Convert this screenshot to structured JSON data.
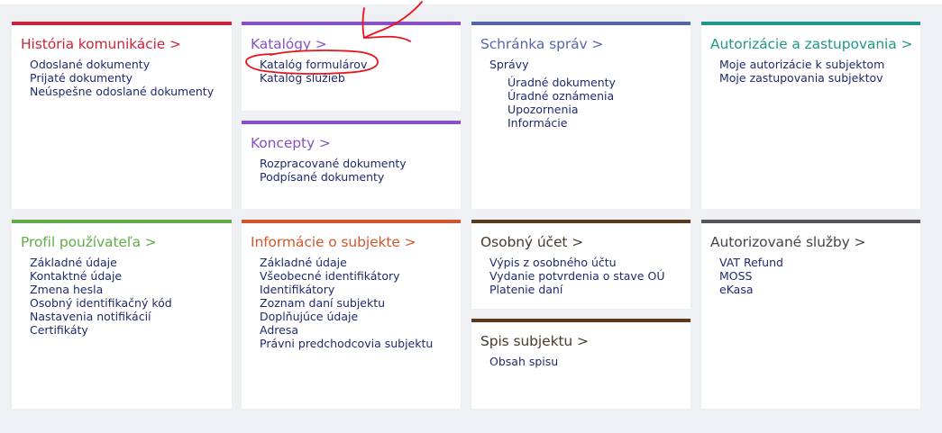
{
  "colors": {
    "red": "#c8253b",
    "purple": "#8750c4",
    "blue": "#5667a8",
    "teal": "#21968a",
    "green": "#5fad47",
    "orange": "#d2572d",
    "brown": "#5b3b1f",
    "gray": "#56565a",
    "annotation": "#e8141c"
  },
  "tiles": {
    "historia": {
      "title": "História komunikácie >",
      "links": [
        "Odoslané dokumenty",
        "Prijaté dokumenty",
        "Neúspešne odoslané dokumenty"
      ]
    },
    "katalogy": {
      "title": "Katalógy >",
      "links": [
        "Katalóg formulárov",
        "Katalóg služieb"
      ]
    },
    "koncepty": {
      "title": "Koncepty >",
      "links": [
        "Rozpracované dokumenty",
        "Podpísané dokumenty"
      ]
    },
    "schranka": {
      "title": "Schránka správ >",
      "links": [
        "Správy",
        "Úradné dokumenty",
        "Úradné oznámenia",
        "Upozornenia",
        "Informácie"
      ]
    },
    "autorizacie": {
      "title": "Autorizácie a zastupovania >",
      "links": [
        "Moje autorizácie k subjektom",
        "Moje zastupovania subjektov"
      ]
    },
    "profil": {
      "title": "Profil používateľa >",
      "links": [
        "Základné údaje",
        "Kontaktné údaje",
        "Zmena hesla",
        "Osobný identifikačný kód",
        "Nastavenia notifikácií",
        "Certifikáty"
      ]
    },
    "informacie": {
      "title": "Informácie o subjekte >",
      "links": [
        "Základné údaje",
        "Všeobecné identifikátory",
        "Identifikátory",
        "Zoznam daní subjektu",
        "Doplňujúce údaje",
        "Adresa",
        "Právni predchodcovia subjektu"
      ]
    },
    "ucet": {
      "title": "Osobný účet >",
      "links": [
        "Výpis z osobného účtu",
        "Vydanie potvrdenia o stave OÚ",
        "Platenie daní"
      ]
    },
    "spis": {
      "title": "Spis subjektu >",
      "links": [
        "Obsah spisu"
      ]
    },
    "sluzby": {
      "title": "Autorizované služby >",
      "links": [
        "VAT Refund",
        "MOSS",
        "eKasa"
      ]
    }
  }
}
